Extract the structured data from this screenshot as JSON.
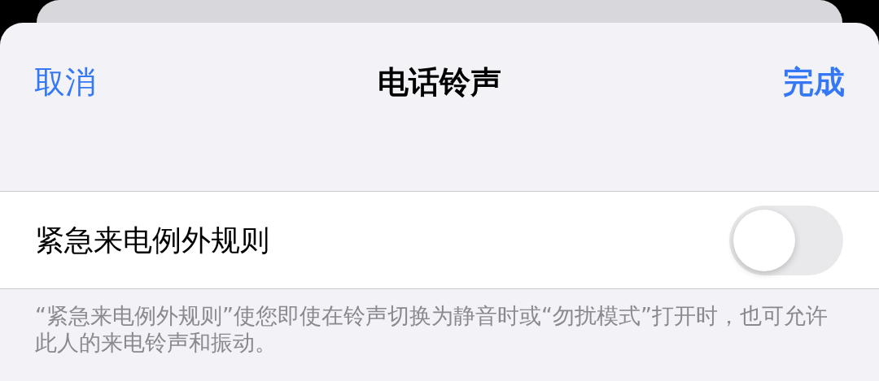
{
  "nav": {
    "cancel": "取消",
    "title": "电话铃声",
    "done": "完成"
  },
  "setting": {
    "label": "紧急来电例外规则",
    "on": false
  },
  "footer": "“紧急来电例外规则”使您即使在铃声切换为静音时或“勿扰模式”打开时，也可允许此人的来电铃声和振动。"
}
